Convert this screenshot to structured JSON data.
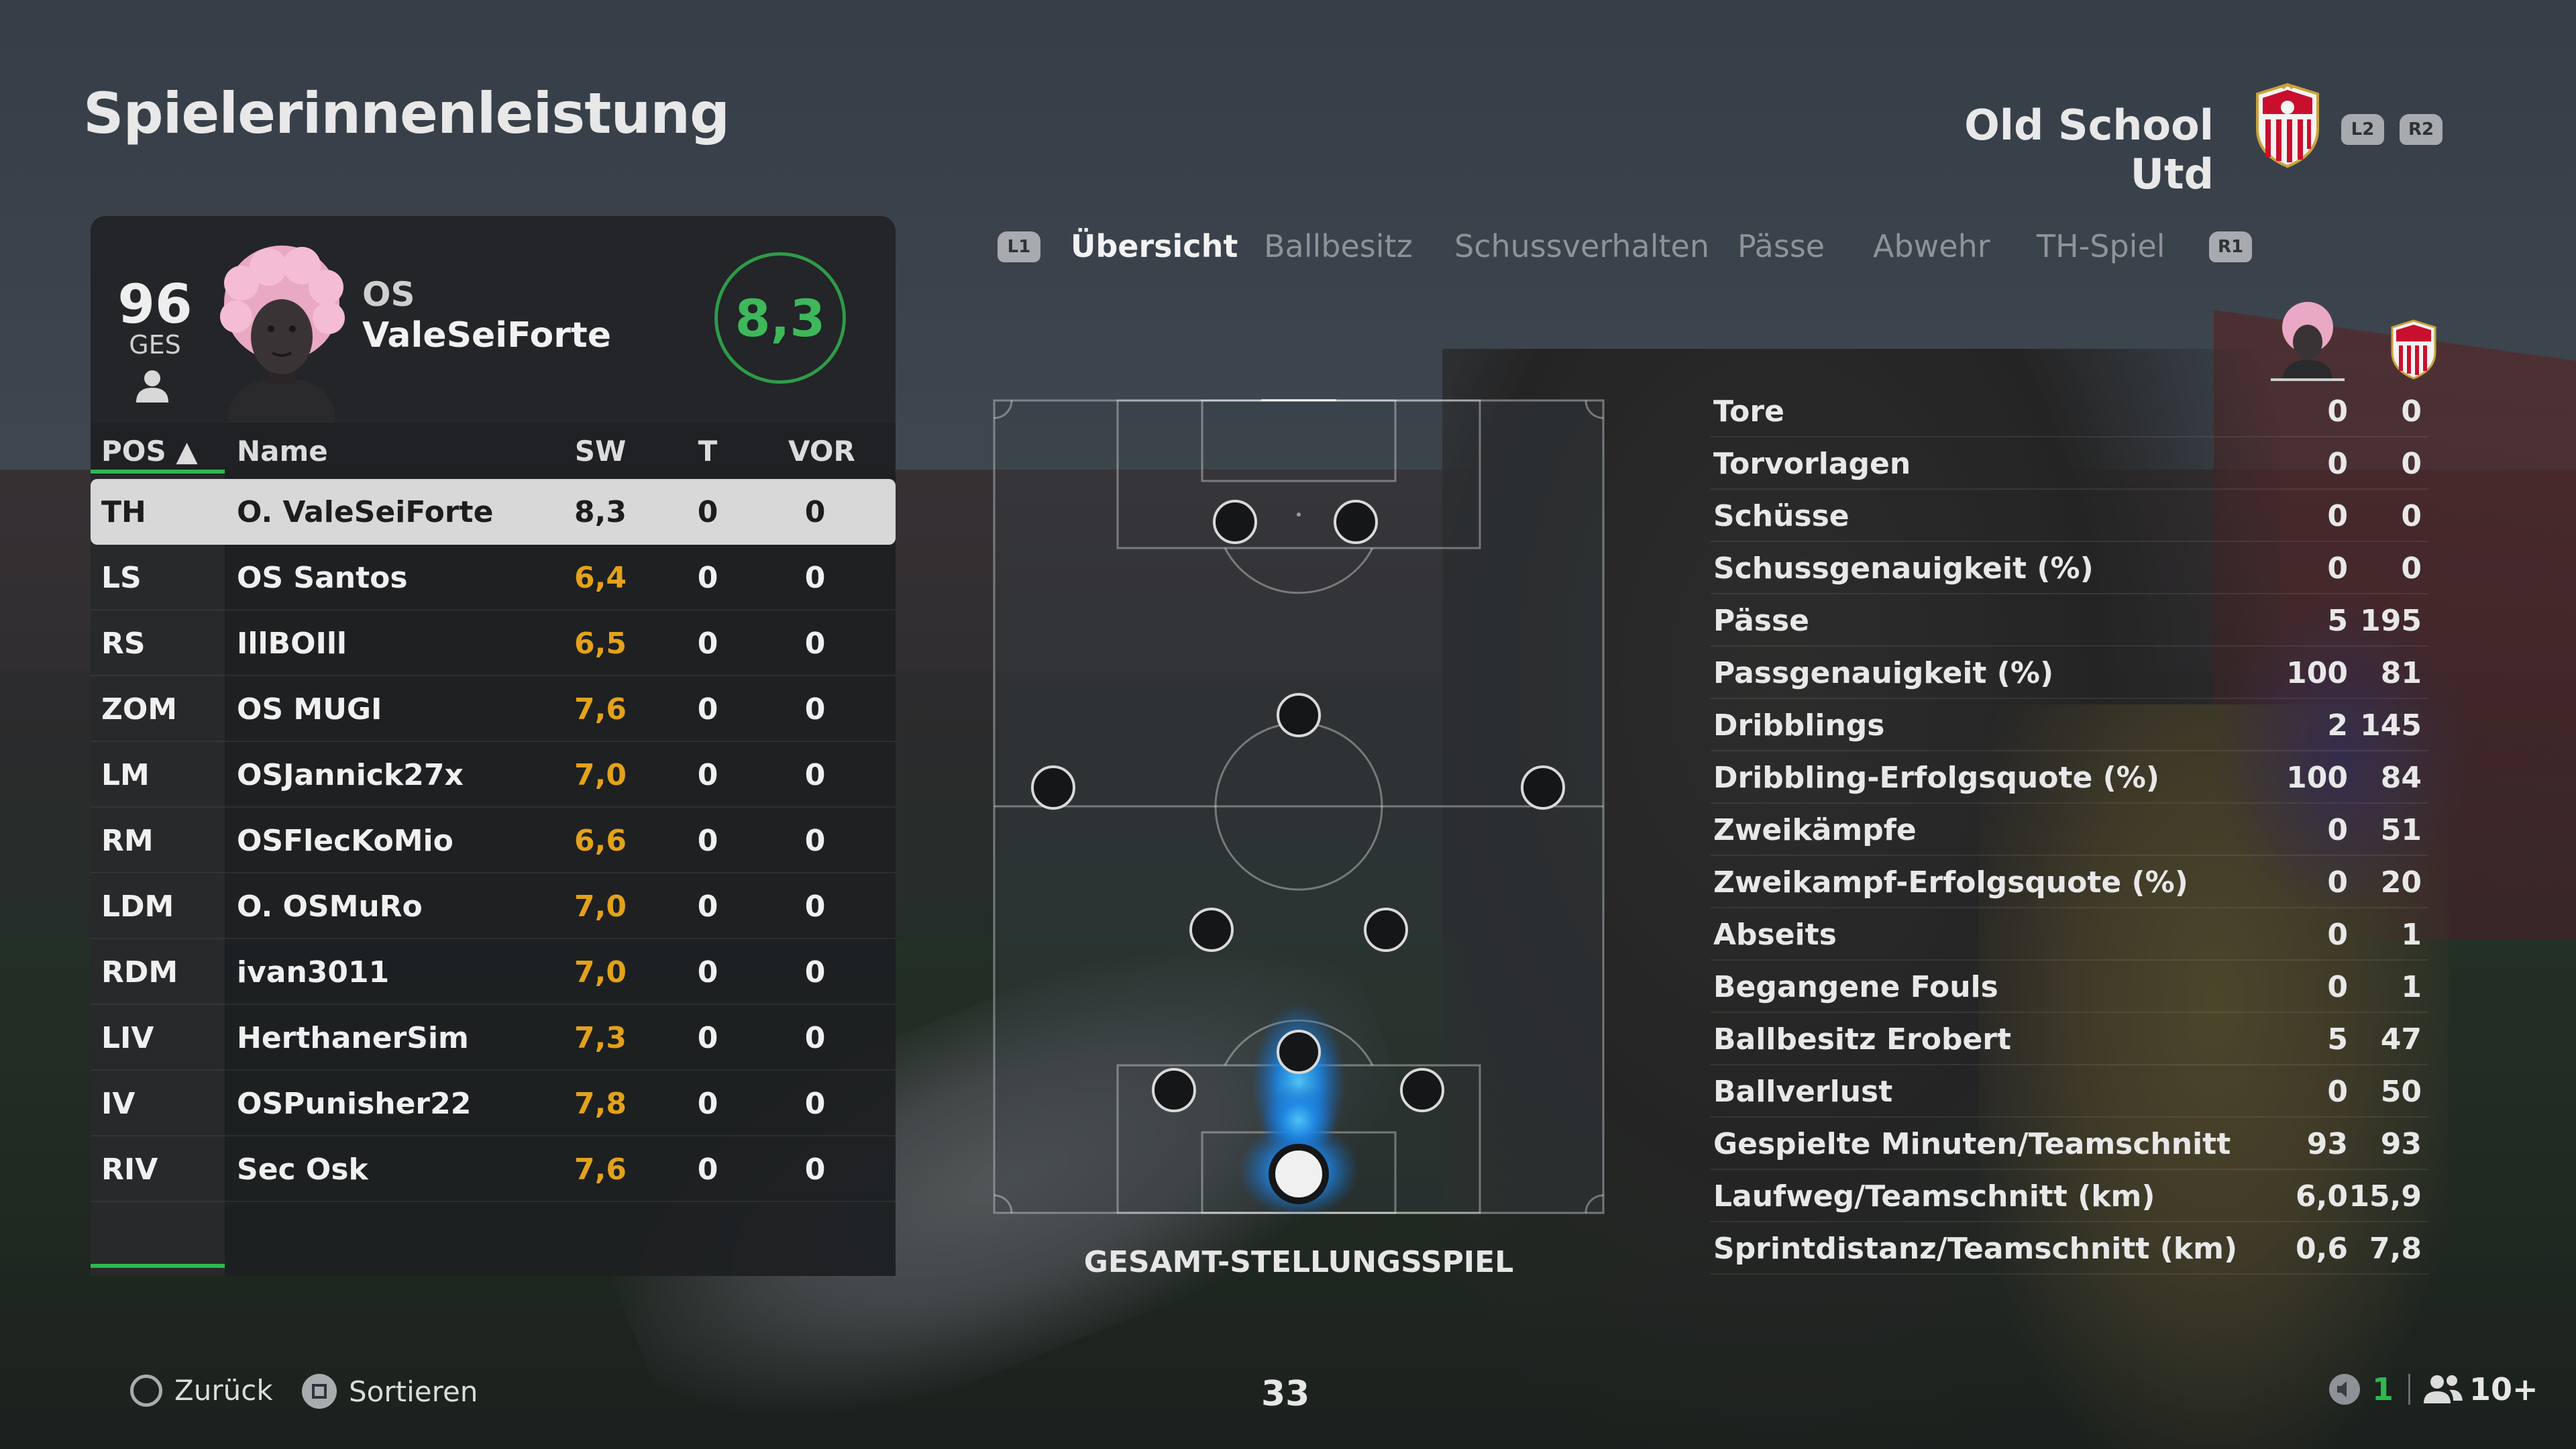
{
  "header": {
    "title": "Spielerinnenleistung",
    "team_name": "Old School Utd",
    "button_l2": "L2",
    "button_r2": "R2"
  },
  "player_card": {
    "overall": "96",
    "overall_label": "GES",
    "name_prefix": "OS",
    "name": "ValeSeiForte",
    "match_rating": "8,3"
  },
  "table": {
    "headers": {
      "pos": "POS ▲",
      "name": "Name",
      "sw": "SW",
      "t": "T",
      "vor": "VOR"
    },
    "rows": [
      {
        "pos": "TH",
        "name": "O. ValeSeiForte",
        "sw": "8,3",
        "t": "0",
        "vor": "0"
      },
      {
        "pos": "LS",
        "name": "OS Santos",
        "sw": "6,4",
        "t": "0",
        "vor": "0"
      },
      {
        "pos": "RS",
        "name": "IllBOIll",
        "sw": "6,5",
        "t": "0",
        "vor": "0"
      },
      {
        "pos": "ZOM",
        "name": "OS MUGI",
        "sw": "7,6",
        "t": "0",
        "vor": "0"
      },
      {
        "pos": "LM",
        "name": "OSJannick27x",
        "sw": "7,0",
        "t": "0",
        "vor": "0"
      },
      {
        "pos": "RM",
        "name": "OSFlecKoMio",
        "sw": "6,6",
        "t": "0",
        "vor": "0"
      },
      {
        "pos": "LDM",
        "name": "O. OSMuRo",
        "sw": "7,0",
        "t": "0",
        "vor": "0"
      },
      {
        "pos": "RDM",
        "name": "ivan3011",
        "sw": "7,0",
        "t": "0",
        "vor": "0"
      },
      {
        "pos": "LIV",
        "name": "HerthanerSim",
        "sw": "7,3",
        "t": "0",
        "vor": "0"
      },
      {
        "pos": "IV",
        "name": "OSPunisher22",
        "sw": "7,8",
        "t": "0",
        "vor": "0"
      },
      {
        "pos": "RIV",
        "name": "Sec Osk",
        "sw": "7,6",
        "t": "0",
        "vor": "0"
      }
    ]
  },
  "tabs": {
    "button_l1": "L1",
    "button_r1": "R1",
    "items": [
      "Übersicht",
      "Ballbesitz",
      "Schussverhalten",
      "Pässe",
      "Abwehr",
      "TH-Spiel"
    ]
  },
  "pitch": {
    "label": "GESAMT-STELLUNGSSPIEL"
  },
  "stats": {
    "rows": [
      {
        "label": "Tore",
        "player": "0",
        "team": "0"
      },
      {
        "label": "Torvorlagen",
        "player": "0",
        "team": "0"
      },
      {
        "label": "Schüsse",
        "player": "0",
        "team": "0"
      },
      {
        "label": "Schussgenauigkeit (%)",
        "player": "0",
        "team": "0"
      },
      {
        "label": "Pässe",
        "player": "5",
        "team": "195"
      },
      {
        "label": "Passgenauigkeit (%)",
        "player": "100",
        "team": "81"
      },
      {
        "label": "Dribblings",
        "player": "2",
        "team": "145"
      },
      {
        "label": "Dribbling-Erfolgsquote (%)",
        "player": "100",
        "team": "84"
      },
      {
        "label": "Zweikämpfe",
        "player": "0",
        "team": "51"
      },
      {
        "label": "Zweikampf-Erfolgsquote (%)",
        "player": "0",
        "team": "20"
      },
      {
        "label": "Abseits",
        "player": "0",
        "team": "1"
      },
      {
        "label": "Begangene Fouls",
        "player": "0",
        "team": "1"
      },
      {
        "label": "Ballbesitz Erobert",
        "player": "5",
        "team": "47"
      },
      {
        "label": "Ballverlust",
        "player": "0",
        "team": "50"
      },
      {
        "label": "Gespielte Minuten/Teamschnitt",
        "player": "93",
        "team": "93"
      },
      {
        "label": "Laufweg/Teamschnitt (km)",
        "player": "6,0",
        "team": "15,9"
      },
      {
        "label": "Sprintdistanz/Teamschnitt (km)",
        "player": "0,6",
        "team": "7,8"
      }
    ]
  },
  "footer": {
    "back_label": "Zurück",
    "sort_label": "Sortieren",
    "page_number": "33",
    "voice_count": "1",
    "players_online": "10+"
  },
  "colors": {
    "accent_green": "#2fb84e",
    "rating_orange": "#e3a21a",
    "heatmap_blue": "#1e88e5"
  }
}
